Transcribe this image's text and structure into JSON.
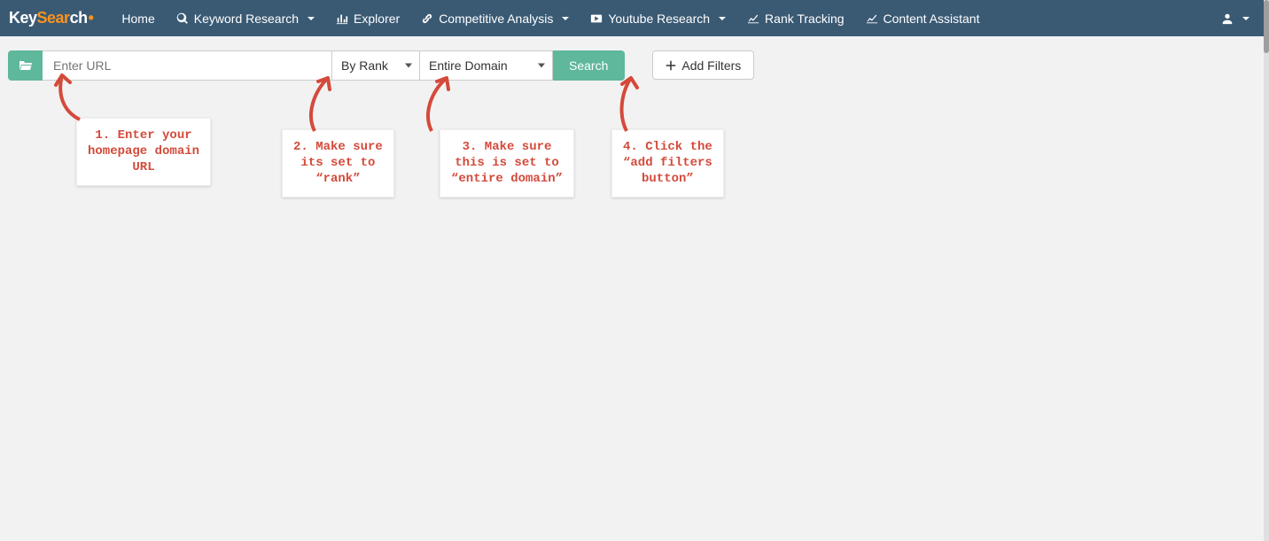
{
  "brand": {
    "part1": "Key",
    "part2": "Sear",
    "part3": "ch"
  },
  "nav": {
    "home": "Home",
    "keyword_research": "Keyword Research",
    "explorer": "Explorer",
    "competitive_analysis": "Competitive Analysis",
    "youtube_research": "Youtube Research",
    "rank_tracking": "Rank Tracking",
    "content_assistant": "Content Assistant"
  },
  "toolbar": {
    "url_placeholder": "Enter URL",
    "rank_select": "By Rank",
    "domain_select": "Entire Domain",
    "search_label": "Search",
    "add_filters_label": "Add Filters"
  },
  "annotations": {
    "a1": "1. Enter your\nhomepage domain\nURL",
    "a2": "2. Make sure\nits set to\n“rank”",
    "a3": "3. Make sure\nthis is set to\n“entire domain”",
    "a4": "4. Click the\n“add filters\nbutton”"
  }
}
